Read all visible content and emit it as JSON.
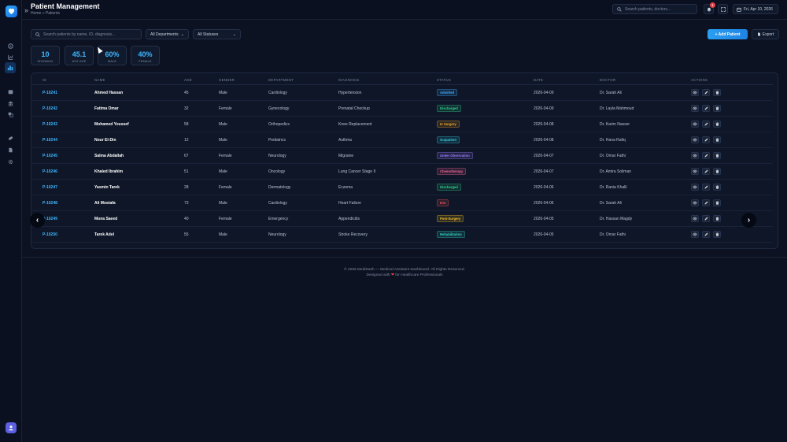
{
  "header": {
    "title": "Patient Management",
    "breadcrumb": "Home » Patients",
    "search_placeholder": "Search patients, doctors...",
    "notification_count": "1",
    "date": "Fri, Apr 10, 2026"
  },
  "toolbar": {
    "search_placeholder": "Search patients by name, ID, diagnosis...",
    "department_filter": "All Departments",
    "status_filter": "All Statuses",
    "add_label": "+ Add Patient",
    "export_label": "Export"
  },
  "stats": [
    {
      "value": "10",
      "label": "SHOWING"
    },
    {
      "value": "45.1",
      "label": "AVG AGE"
    },
    {
      "value": "60%",
      "label": "MALE"
    },
    {
      "value": "40%",
      "label": "FEMALE"
    }
  ],
  "table": {
    "columns": [
      "ID",
      "NAME",
      "AGE",
      "GENDER",
      "DEPARTMENT",
      "DIAGNOSIS",
      "STATUS",
      "DATE",
      "DOCTOR",
      "ACTIONS"
    ],
    "rows": [
      {
        "id": "P-10241",
        "name": "Ahmed Hassan",
        "age": "45",
        "gender": "Male",
        "dept": "Cardiology",
        "diagnosis": "Hypertension",
        "status": "Admitted",
        "date": "2026-04-09",
        "doctor": "Dr. Sarah Ali"
      },
      {
        "id": "P-10242",
        "name": "Fatima Omar",
        "age": "32",
        "gender": "Female",
        "dept": "Gynecology",
        "diagnosis": "Prenatal Checkup",
        "status": "Discharged",
        "date": "2026-04-09",
        "doctor": "Dr. Layla Mahmoud"
      },
      {
        "id": "P-10243",
        "name": "Mohamed Youssef",
        "age": "58",
        "gender": "Male",
        "dept": "Orthopedics",
        "diagnosis": "Knee Replacement",
        "status": "In Surgery",
        "date": "2026-04-08",
        "doctor": "Dr. Karim Nasser"
      },
      {
        "id": "P-10244",
        "name": "Nour El-Din",
        "age": "12",
        "gender": "Male",
        "dept": "Pediatrics",
        "diagnosis": "Asthma",
        "status": "Outpatient",
        "date": "2026-04-08",
        "doctor": "Dr. Hana Rafiq"
      },
      {
        "id": "P-10245",
        "name": "Salma Abdallah",
        "age": "67",
        "gender": "Female",
        "dept": "Neurology",
        "diagnosis": "Migraine",
        "status": "Under Observation",
        "date": "2026-04-07",
        "doctor": "Dr. Omar Fathi"
      },
      {
        "id": "P-10246",
        "name": "Khaled Ibrahim",
        "age": "51",
        "gender": "Male",
        "dept": "Oncology",
        "diagnosis": "Lung Cancer Stage II",
        "status": "Chemotherapy",
        "date": "2026-04-07",
        "doctor": "Dr. Amira Soliman"
      },
      {
        "id": "P-10247",
        "name": "Yasmin Tarek",
        "age": "28",
        "gender": "Female",
        "dept": "Dermatology",
        "diagnosis": "Eczema",
        "status": "Discharged",
        "date": "2026-04-06",
        "doctor": "Dr. Rania Khalil"
      },
      {
        "id": "P-10248",
        "name": "Ali Mostafa",
        "age": "73",
        "gender": "Male",
        "dept": "Cardiology",
        "diagnosis": "Heart Failure",
        "status": "ICU",
        "date": "2026-04-06",
        "doctor": "Dr. Sarah Ali"
      },
      {
        "id": "P-10249",
        "name": "Mona Saeed",
        "age": "40",
        "gender": "Female",
        "dept": "Emergency",
        "diagnosis": "Appendicitis",
        "status": "Post-Surgery",
        "date": "2026-04-05",
        "doctor": "Dr. Hassan Magdy"
      },
      {
        "id": "P-10250",
        "name": "Tarek Adel",
        "age": "55",
        "gender": "Male",
        "dept": "Neurology",
        "diagnosis": "Stroke Recovery",
        "status": "Rehabilitation",
        "date": "2026-04-05",
        "doctor": "Dr. Omar Fathi"
      }
    ]
  },
  "status_colors": {
    "Admitted": "#3fa9ff",
    "Discharged": "#2fd08a",
    "In Surgery": "#f5a524",
    "Outpatient": "#34c8e0",
    "Under Observation": "#9a7bff",
    "Chemotherapy": "#f06292",
    "ICU": "#ff5a5a",
    "Post-Surgery": "#f5c024",
    "Rehabilitation": "#2fd0c0"
  },
  "footer": {
    "line1": "© 2026 MediDash — Medical Assistant Dashboard. All Rights Reserved.",
    "line2_pre": "Designed with",
    "line2_post": "for Healthcare Professionals"
  },
  "icons": [
    "heart-shield-icon",
    "expand-icon",
    "dashboard-icon",
    "chart-icon",
    "patients-icon",
    "calendar-icon",
    "building-icon",
    "staff-icon",
    "pharmacy-icon",
    "reports-icon",
    "settings-icon",
    "user-icon",
    "search-icon",
    "bell-icon",
    "fullscreen-icon",
    "calendar-icon",
    "eye-icon",
    "edit-icon",
    "trash-icon",
    "chevron-left-icon",
    "chevron-right-icon"
  ]
}
